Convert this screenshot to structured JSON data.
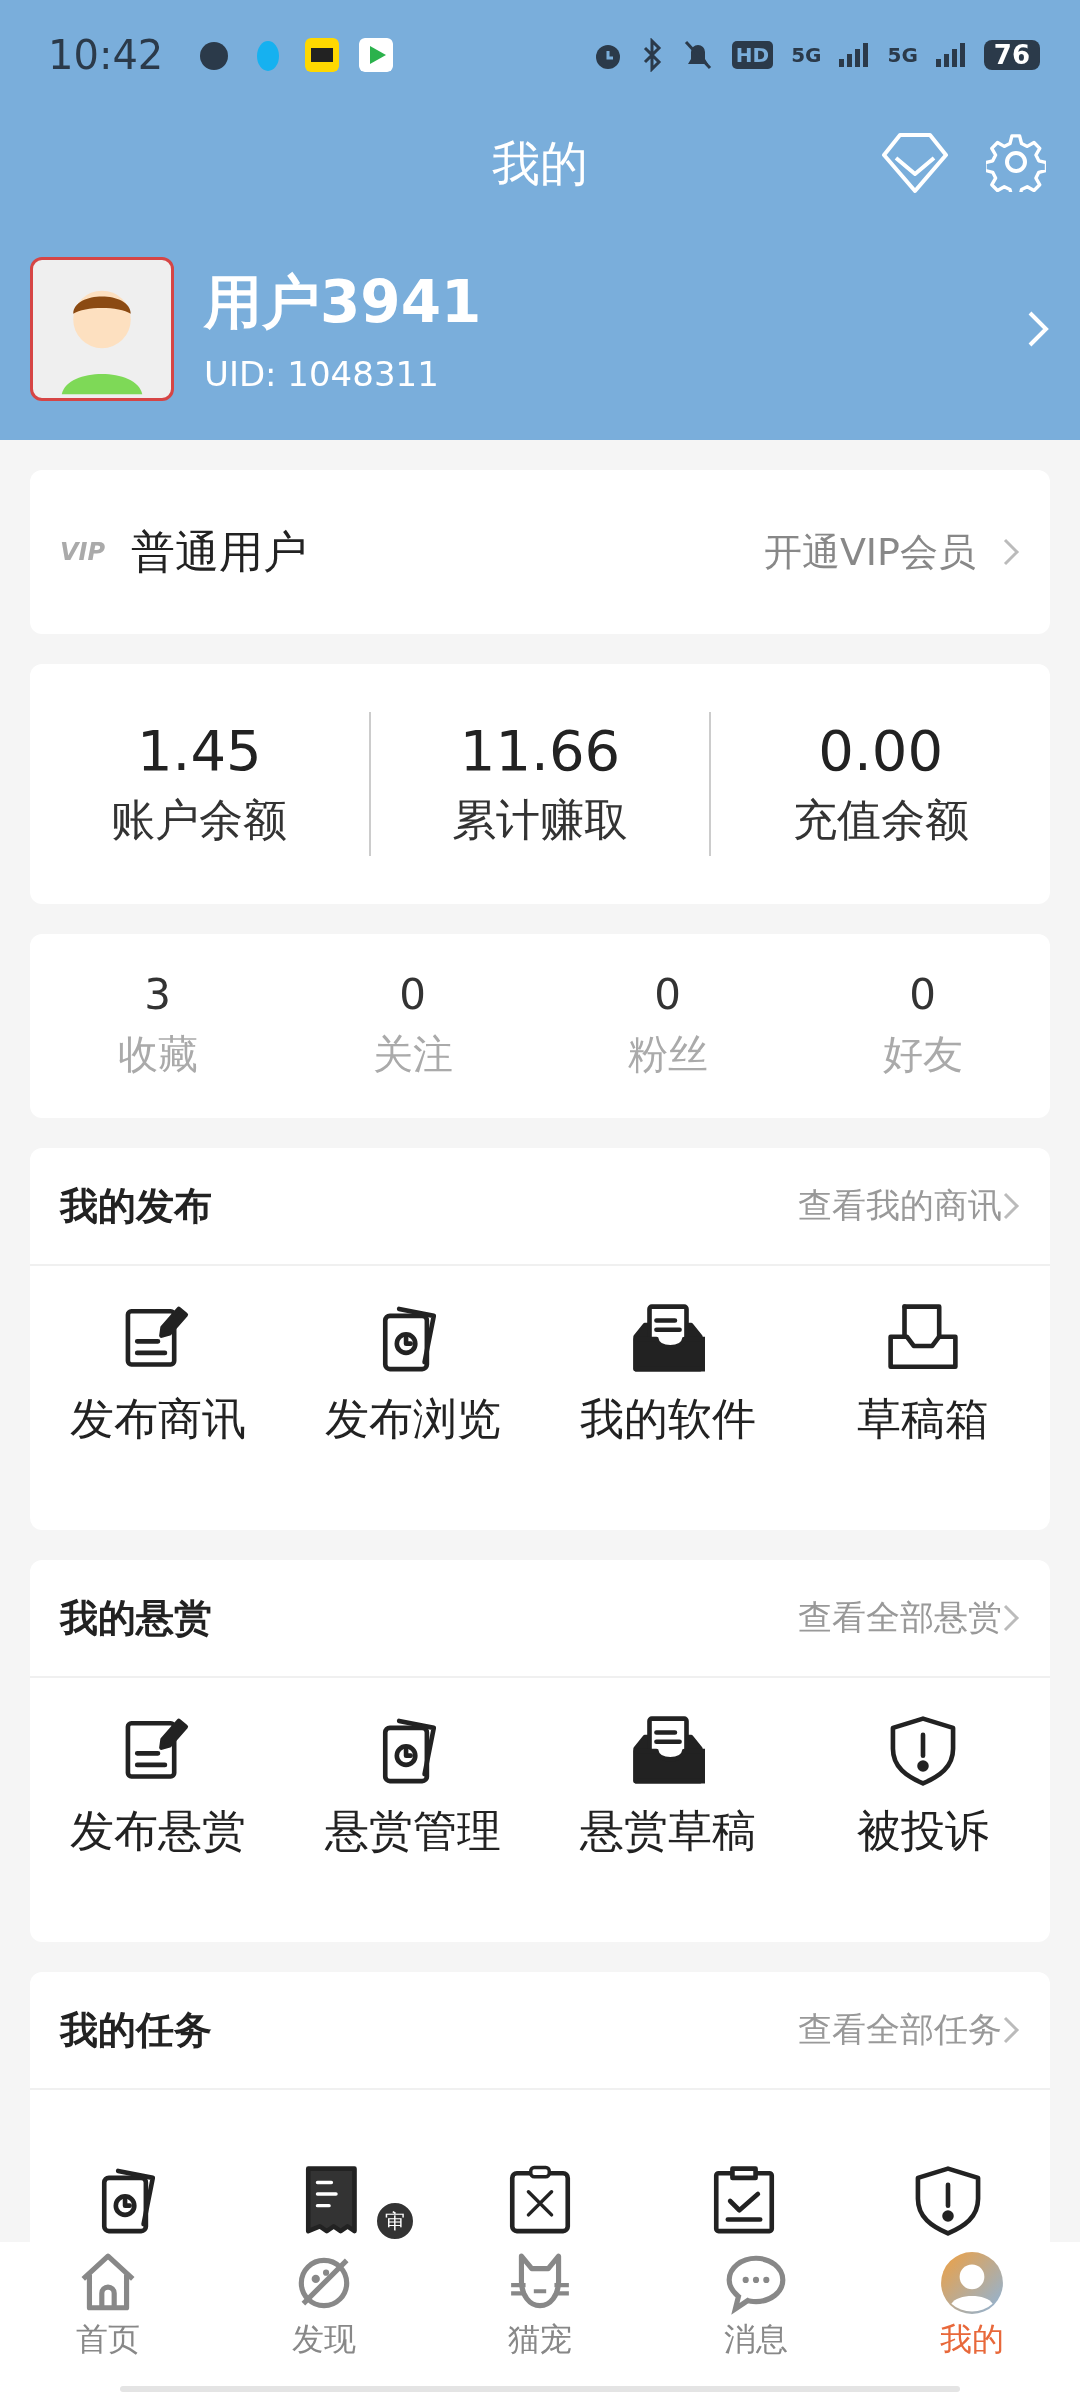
{
  "status_bar": {
    "time": "10:42",
    "hd": "HD",
    "networks": [
      "5G",
      "5G"
    ],
    "battery": "76"
  },
  "header": {
    "title": "我的"
  },
  "profile": {
    "name": "用户3941",
    "uid": "UID: 1048311"
  },
  "vip": {
    "badge": "VIP",
    "level": "普通用户",
    "action": "开通VIP会员"
  },
  "balances": [
    {
      "value": "1.45",
      "label": "账户余额"
    },
    {
      "value": "11.66",
      "label": "累计赚取"
    },
    {
      "value": "0.00",
      "label": "充值余额"
    }
  ],
  "counts": [
    {
      "value": "3",
      "label": "收藏"
    },
    {
      "value": "0",
      "label": "关注"
    },
    {
      "value": "0",
      "label": "粉丝"
    },
    {
      "value": "0",
      "label": "好友"
    }
  ],
  "sections": [
    {
      "title": "我的发布",
      "link": "查看我的商讯",
      "items": [
        {
          "label": "发布商讯"
        },
        {
          "label": "发布浏览"
        },
        {
          "label": "我的软件"
        },
        {
          "label": "草稿箱"
        }
      ]
    },
    {
      "title": "我的悬赏",
      "link": "查看全部悬赏",
      "items": [
        {
          "label": "发布悬赏"
        },
        {
          "label": "悬赏管理"
        },
        {
          "label": "悬赏草稿"
        },
        {
          "label": "被投诉"
        }
      ]
    },
    {
      "title": "我的任务",
      "link": "查看全部任务",
      "icon_badge": "审"
    }
  ],
  "tabs": [
    {
      "label": "首页",
      "selected": false
    },
    {
      "label": "发现",
      "selected": false
    },
    {
      "label": "猫宠",
      "selected": false
    },
    {
      "label": "消息",
      "selected": false
    },
    {
      "label": "我的",
      "selected": true
    }
  ]
}
